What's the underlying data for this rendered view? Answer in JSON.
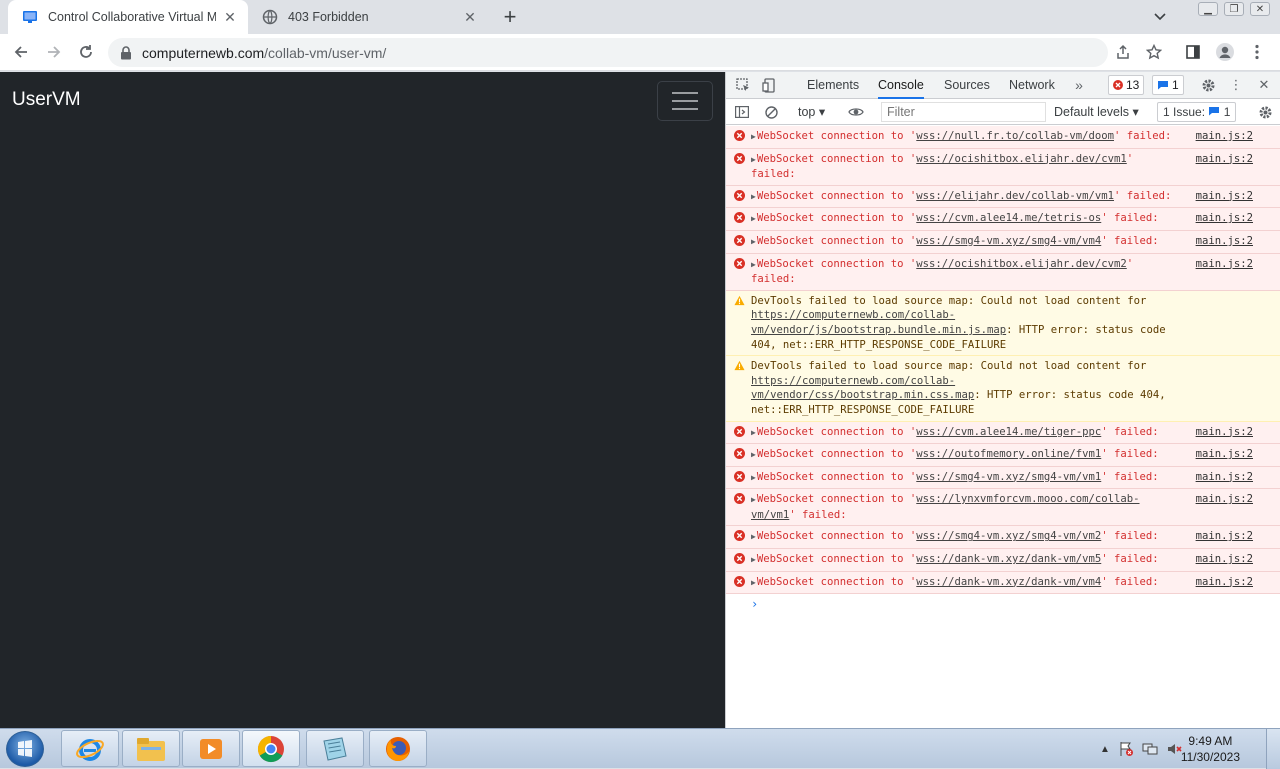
{
  "browser": {
    "tabs": [
      {
        "title": "Control Collaborative Virtual Ma",
        "favicon": "monitor-icon",
        "active": true
      },
      {
        "title": "403 Forbidden",
        "favicon": "globe-icon",
        "active": false
      }
    ],
    "address": {
      "host": "computernewb.com",
      "path": "/collab-vm/user-vm/"
    }
  },
  "page": {
    "brand": "UserVM"
  },
  "devtools": {
    "tabs": [
      "Elements",
      "Console",
      "Sources",
      "Network"
    ],
    "active_tab": "Console",
    "error_count": "13",
    "message_count": "1",
    "context": "top",
    "filter_placeholder": "Filter",
    "levels": "Default levels",
    "issues_label": "1 Issue:",
    "issues_count": "1",
    "messages": [
      {
        "type": "error",
        "pre": "WebSocket connection to '",
        "link": "wss://null.fr.to/collab-vm/doom",
        "post": "' failed:",
        "src": "main.js:2"
      },
      {
        "type": "error",
        "pre": "WebSocket connection to '",
        "link": "wss://ocishitbox.elijahr.dev/cvm1",
        "post": "' failed:",
        "src": "main.js:2"
      },
      {
        "type": "error",
        "pre": "WebSocket connection to '",
        "link": "wss://elijahr.dev/collab-vm/vm1",
        "post": "' failed:",
        "src": "main.js:2"
      },
      {
        "type": "error",
        "pre": "WebSocket connection to '",
        "link": "wss://cvm.alee14.me/tetris-os",
        "post": "' failed:",
        "src": "main.js:2"
      },
      {
        "type": "error",
        "pre": "WebSocket connection to '",
        "link": "wss://smg4-vm.xyz/smg4-vm/vm4",
        "post": "' failed:",
        "src": "main.js:2"
      },
      {
        "type": "error",
        "pre": "WebSocket connection to '",
        "link": "wss://ocishitbox.elijahr.dev/cvm2",
        "post": "' failed:",
        "src": "main.js:2"
      },
      {
        "type": "warning",
        "pre": "DevTools failed to load source map: Could not load content for ",
        "link": "https://computernewb.com/collab-vm/vendor/js/bootstrap.bundle.min.js.map",
        "post": ": HTTP error: status code 404, net::ERR_HTTP_RESPONSE_CODE_FAILURE",
        "src": ""
      },
      {
        "type": "warning",
        "pre": "DevTools failed to load source map: Could not load content for ",
        "link": "https://computernewb.com/collab-vm/vendor/css/bootstrap.min.css.map",
        "post": ": HTTP error: status code 404, net::ERR_HTTP_RESPONSE_CODE_FAILURE",
        "src": ""
      },
      {
        "type": "error",
        "pre": "WebSocket connection to '",
        "link": "wss://cvm.alee14.me/tiger-ppc",
        "post": "' failed:",
        "src": "main.js:2"
      },
      {
        "type": "error",
        "pre": "WebSocket connection to '",
        "link": "wss://outofmemory.online/fvm1",
        "post": "' failed:",
        "src": "main.js:2"
      },
      {
        "type": "error",
        "pre": "WebSocket connection to '",
        "link": "wss://smg4-vm.xyz/smg4-vm/vm1",
        "post": "' failed:",
        "src": "main.js:2"
      },
      {
        "type": "error",
        "pre": "WebSocket connection to '",
        "link": "wss://lynxvmforcvm.mooo.com/collab-vm/vm1",
        "post": "' failed:",
        "src": "main.js:2"
      },
      {
        "type": "error",
        "pre": "WebSocket connection to '",
        "link": "wss://smg4-vm.xyz/smg4-vm/vm2",
        "post": "' failed:",
        "src": "main.js:2"
      },
      {
        "type": "error",
        "pre": "WebSocket connection to '",
        "link": "wss://dank-vm.xyz/dank-vm/vm5",
        "post": "' failed:",
        "src": "main.js:2"
      },
      {
        "type": "error",
        "pre": "WebSocket connection to '",
        "link": "wss://dank-vm.xyz/dank-vm/vm4",
        "post": "' failed:",
        "src": "main.js:2"
      }
    ]
  },
  "taskbar": {
    "apps": [
      "internet-explorer-icon",
      "file-explorer-icon",
      "media-player-icon",
      "chrome-icon",
      "notepad-icon",
      "firefox-icon"
    ],
    "time": "9:49 AM",
    "date": "11/30/2023"
  }
}
